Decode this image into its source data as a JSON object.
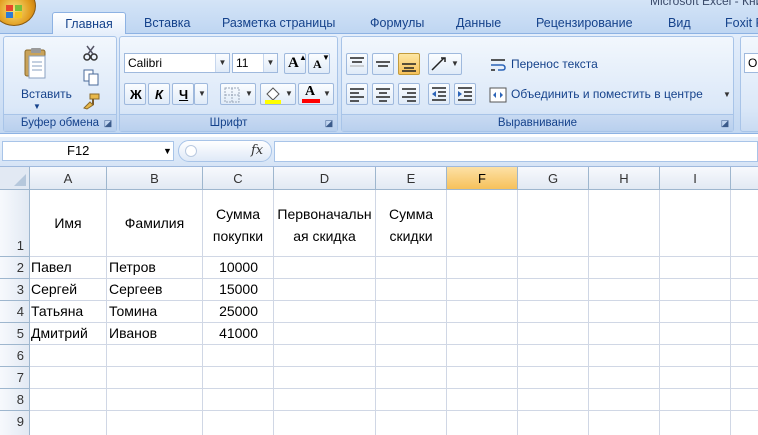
{
  "window": {
    "title": "Microsoft Excel - Книга"
  },
  "tabs": [
    "Главная",
    "Вставка",
    "Разметка страницы",
    "Формулы",
    "Данные",
    "Рецензирование",
    "Вид",
    "Foxit R"
  ],
  "active_tab": "Главная",
  "ribbon": {
    "clipboard": {
      "paste_label": "Вставить",
      "group_label": "Буфер обмена"
    },
    "font": {
      "font_name": "Calibri",
      "font_size": "11",
      "bold": "Ж",
      "italic": "К",
      "underline": "Ч",
      "grow": "A",
      "shrink": "A",
      "group_label": "Шрифт",
      "fill_color": "#ffff00",
      "font_color": "#ff0000"
    },
    "alignment": {
      "wrap_text": "Перенос текста",
      "merge_center": "Объединить и поместить в центре",
      "group_label": "Выравнивание"
    },
    "number": {
      "partial": "О"
    }
  },
  "formula_bar": {
    "name_box": "F12",
    "fx": "fx",
    "formula": ""
  },
  "columns": [
    "A",
    "B",
    "C",
    "D",
    "E",
    "F",
    "G",
    "H",
    "I"
  ],
  "selected_column": "F",
  "rows": [
    "1",
    "2",
    "3",
    "4",
    "5",
    "6",
    "7",
    "8",
    "9"
  ],
  "table": {
    "headers": {
      "name": "Имя",
      "surname": "Фамилия",
      "amount": "Сумма покупки",
      "initial_discount": "Первоначальная скидка",
      "discount_sum": "Сумма скидки"
    },
    "data": [
      {
        "name": "Павел",
        "surname": "Петров",
        "amount": "10000"
      },
      {
        "name": "Сергей",
        "surname": "Сергеев",
        "amount": "15000"
      },
      {
        "name": "Татьяна",
        "surname": "Томина",
        "amount": "25000"
      },
      {
        "name": "Дмитрий",
        "surname": "Иванов",
        "amount": "41000"
      }
    ]
  }
}
